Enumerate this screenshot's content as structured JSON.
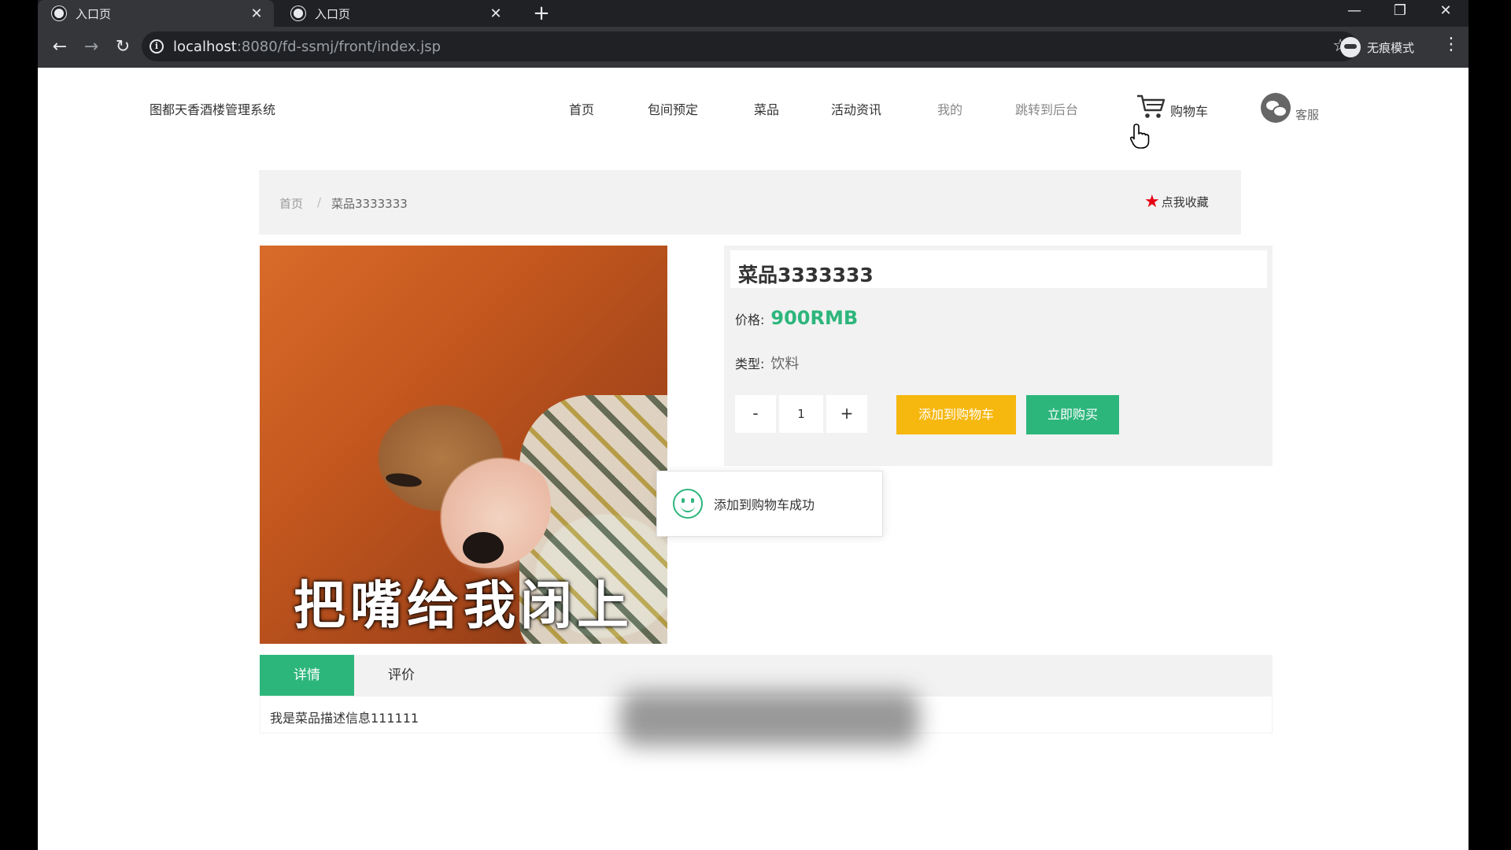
{
  "browser": {
    "tabs": [
      {
        "title": "入口页"
      },
      {
        "title": "入口页"
      }
    ],
    "url_host": "localhost",
    "url_path": ":8080/fd-ssmj/front/index.jsp",
    "incognito_label": "无痕模式",
    "icons": {
      "tab_close": "✕",
      "new_tab": "+",
      "minimize": "—",
      "restore": "❐",
      "close": "✕",
      "back": "←",
      "forward": "→",
      "reload": "↻",
      "info": "i",
      "bookmark": "☆",
      "menu": "⋮"
    }
  },
  "header": {
    "site_name": "图都天香酒楼管理系统",
    "nav": [
      {
        "label": "首页"
      },
      {
        "label": "包间预定"
      },
      {
        "label": "菜品"
      },
      {
        "label": "活动资讯"
      },
      {
        "label": "我的"
      },
      {
        "label": "跳转到后台"
      }
    ],
    "cart_label": "购物车",
    "service_label": "客服"
  },
  "breadcrumb": {
    "home": "首页",
    "separator": "/",
    "current": "菜品3333333",
    "favorite_label": "点我收藏",
    "favorite_star": "★"
  },
  "product": {
    "image_caption": "把嘴给我闭上",
    "name": "菜品3333333",
    "price_label": "价格:",
    "price": "900RMB",
    "type_label": "类型:",
    "type": "饮料",
    "qty_minus": "-",
    "quantity": "1",
    "qty_plus": "+",
    "add_to_cart_label": "添加到购物车",
    "buy_now_label": "立即购买"
  },
  "toast": {
    "message": "添加到购物车成功"
  },
  "detail_tabs": [
    {
      "label": "详情"
    },
    {
      "label": "评价"
    }
  ],
  "description": "我是菜品描述信息111111",
  "colors": {
    "accent_green": "#2db67c",
    "cart_button_yellow": "#f6b70f",
    "favorite_red": "#e60012"
  }
}
